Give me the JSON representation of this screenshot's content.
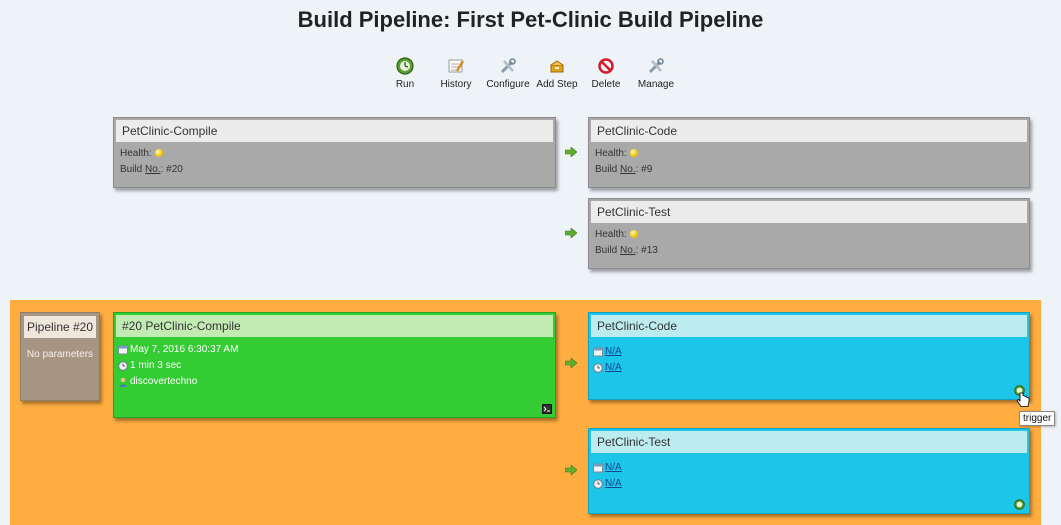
{
  "title": "Build Pipeline: First Pet-Clinic Build Pipeline",
  "toolbar": [
    {
      "label": "Run",
      "icon": "run-icon"
    },
    {
      "label": "History",
      "icon": "history-icon"
    },
    {
      "label": "Configure",
      "icon": "configure-icon"
    },
    {
      "label": "Add Step",
      "icon": "add-step-icon"
    },
    {
      "label": "Delete",
      "icon": "delete-icon"
    },
    {
      "label": "Manage",
      "icon": "manage-icon"
    }
  ],
  "jobs": {
    "compile": {
      "name": "PetClinic-Compile",
      "health_label": "Health:",
      "build_label": "Build No.: #20",
      "build_prefix": "Build ",
      "build_no": "No.",
      "build_value": ": #20"
    },
    "code": {
      "name": "PetClinic-Code",
      "health_label": "Health:",
      "build_prefix": "Build ",
      "build_no": "No.",
      "build_value": ": #9"
    },
    "test": {
      "name": "PetClinic-Test",
      "health_label": "Health:",
      "build_prefix": "Build ",
      "build_no": "No.",
      "build_value": ": #13"
    }
  },
  "pipeline": {
    "label": "Pipeline #20",
    "params": "No parameters"
  },
  "builds": {
    "compile": {
      "title": "#20 PetClinic-Compile",
      "date": "May 7, 2016 6:30:37 AM",
      "duration": "1 min 3 sec",
      "user": "discovertechno"
    },
    "code": {
      "title": "PetClinic-Code",
      "date": "N/A",
      "duration": "N/A"
    },
    "test": {
      "title": "PetClinic-Test",
      "date": "N/A",
      "duration": "N/A"
    }
  },
  "tooltip": "trigger",
  "colors": {
    "background": "#eef3f8",
    "job_box": "#a9a9a9",
    "build_section": "#ffad40",
    "success": "#33cc33",
    "pending": "#1cc6e8",
    "health": "#f2c600"
  }
}
